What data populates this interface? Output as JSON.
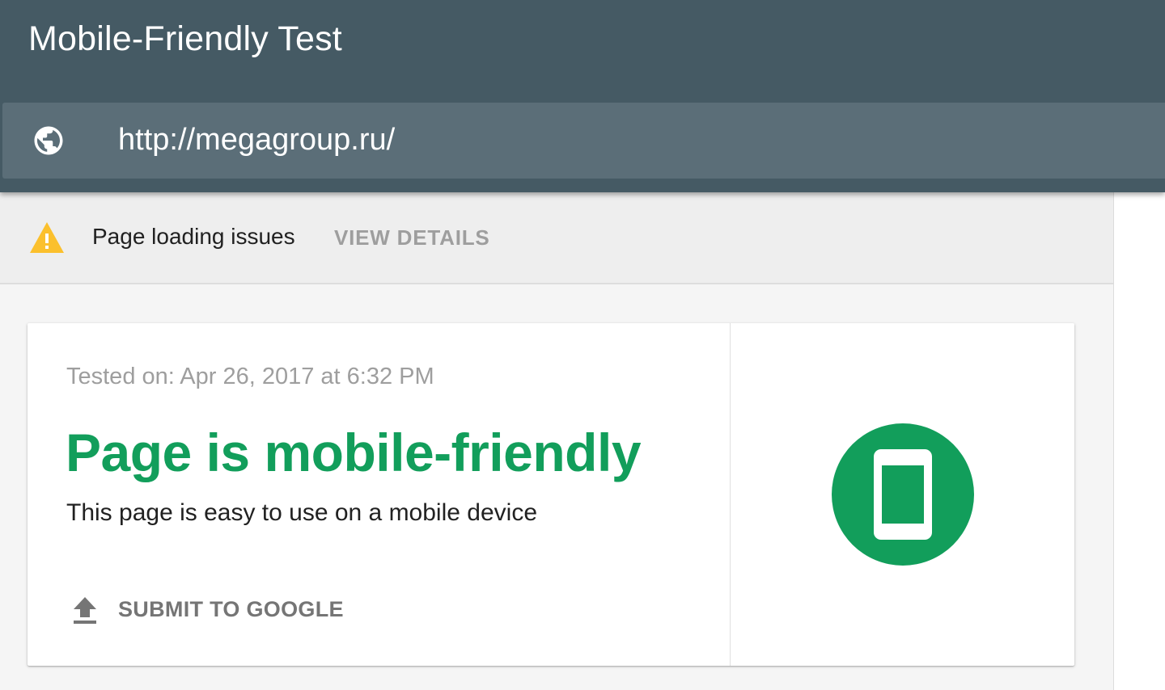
{
  "header": {
    "title": "Mobile-Friendly Test",
    "url_icon": "globe-icon",
    "url_value": "http://megagroup.ru/"
  },
  "issues": {
    "icon": "warning-icon",
    "label": "Page loading issues",
    "action": "VIEW DETAILS"
  },
  "result": {
    "tested_on": "Tested on: Apr 26, 2017 at 6:32 PM",
    "title": "Page is mobile-friendly",
    "description": "This page is easy to use on a mobile device",
    "submit_icon": "upload-icon",
    "submit_label": "SUBMIT TO GOOGLE",
    "badge_icon": "smartphone-icon"
  },
  "colors": {
    "header_bg": "#455a64",
    "url_bar_bg": "#5b6e78",
    "success_green": "#129e5b",
    "warning_yellow": "#fbc02d"
  }
}
